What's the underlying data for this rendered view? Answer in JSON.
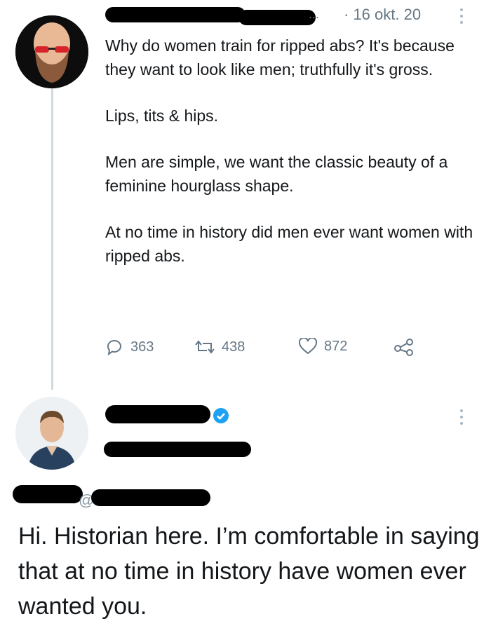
{
  "tweet": {
    "author_avatar": "bald-bearded-man-sunglasses-avatar",
    "date": "· 16 okt. 20",
    "ellipsis": "...",
    "paragraphs": [
      "Why do women train for ripped abs?  It's because they want to look like men; truthfully it's gross.",
      "Lips, tits & hips.",
      "Men are simple, we want the classic beauty of a feminine hourglass shape.",
      "At no time in history did men ever want women with ripped abs."
    ],
    "actions": {
      "replies": "363",
      "retweets": "438",
      "likes": "872"
    }
  },
  "reply": {
    "author_avatar": "man-in-blue-shirt-avatar",
    "verified_icon": "verified-badge-icon",
    "at_sign": "@",
    "text": "Hi. Historian here. I’m comfortable in saying that at no time in history have women ever wanted you."
  },
  "colors": {
    "text": "#14171a",
    "muted": "#657786",
    "verified": "#1da1f2",
    "thread_line": "#cfd9de",
    "redaction": "#000000"
  }
}
